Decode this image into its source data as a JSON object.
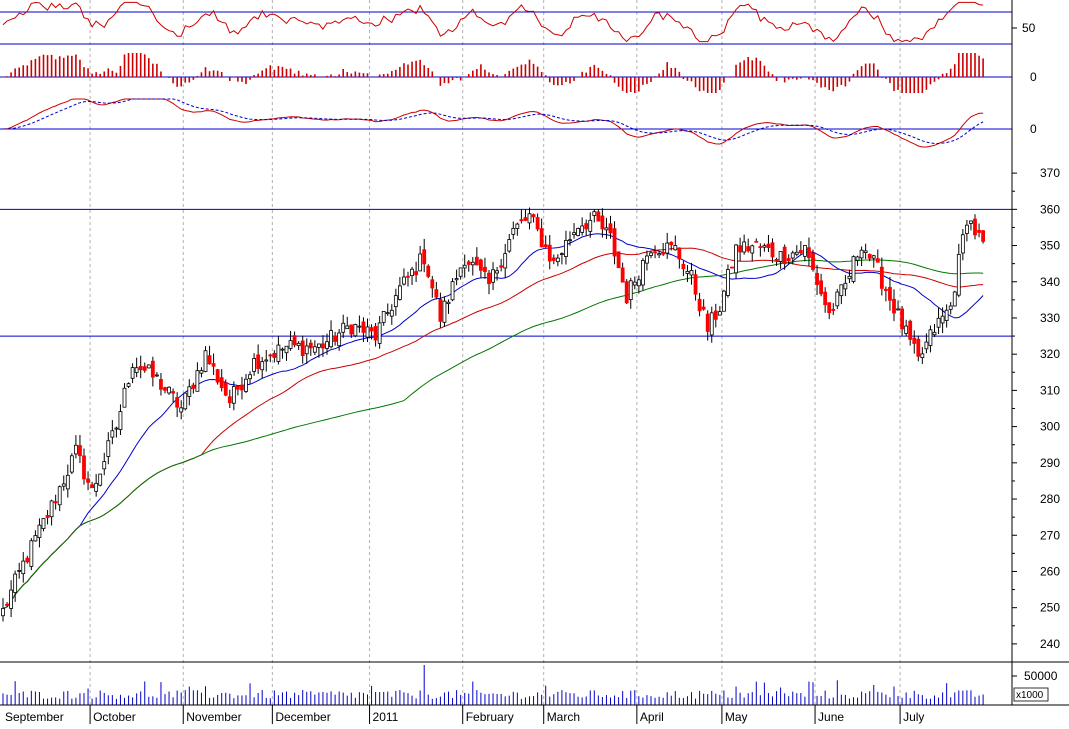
{
  "chart_data": {
    "type": "candlestick",
    "instrument": "",
    "title": "",
    "x_month_labels": [
      "September",
      "October",
      "November",
      "December",
      "2011",
      "February",
      "March",
      "April",
      "May",
      "June",
      "July"
    ],
    "price_panel": {
      "y_ticks": [
        240,
        250,
        260,
        270,
        280,
        290,
        300,
        310,
        320,
        330,
        340,
        350,
        360,
        370
      ],
      "ylim": [
        235,
        375
      ],
      "reference_lines": [
        360,
        325
      ],
      "up_color": "#ffffff",
      "down_color": "#ff0000",
      "moving_averages": [
        {
          "color": "#0000cc",
          "period": 20
        },
        {
          "color": "#cc0000",
          "period": 50
        },
        {
          "color": "#007700",
          "period": 100
        }
      ]
    },
    "rsi_panel": {
      "tick_labels": [
        "50"
      ],
      "reference_lines": [
        70,
        30
      ],
      "line_color": "#cc0000"
    },
    "histogram_panel": {
      "tick_labels": [
        "0"
      ],
      "color": "#cc0000"
    },
    "macd_panel": {
      "tick_labels": [
        "0"
      ],
      "line_color": "#cc0000",
      "signal_color": "#0000cc"
    },
    "volume_panel": {
      "tick_labels": [
        "50000"
      ],
      "unit_label": "x1000",
      "color": "#0000cc"
    },
    "close_waypoints": [
      [
        0,
        249
      ],
      [
        5,
        262
      ],
      [
        12,
        278
      ],
      [
        18,
        293
      ],
      [
        22,
        282
      ],
      [
        28,
        300
      ],
      [
        32,
        318
      ],
      [
        38,
        313
      ],
      [
        44,
        305
      ],
      [
        50,
        320
      ],
      [
        56,
        307
      ],
      [
        62,
        318
      ],
      [
        70,
        322
      ],
      [
        78,
        322
      ],
      [
        86,
        328
      ],
      [
        92,
        325
      ],
      [
        98,
        338
      ],
      [
        104,
        347
      ],
      [
        108,
        330
      ],
      [
        114,
        347
      ],
      [
        120,
        339
      ],
      [
        126,
        354
      ],
      [
        130,
        358
      ],
      [
        136,
        345
      ],
      [
        142,
        356
      ],
      [
        146,
        357
      ],
      [
        150,
        352
      ],
      [
        154,
        336
      ],
      [
        160,
        350
      ],
      [
        166,
        349
      ],
      [
        170,
        341
      ],
      [
        174,
        327
      ],
      [
        177,
        333
      ],
      [
        181,
        349
      ],
      [
        186,
        350
      ],
      [
        192,
        347
      ],
      [
        198,
        349
      ],
      [
        204,
        331
      ],
      [
        208,
        339
      ],
      [
        212,
        351
      ],
      [
        216,
        343
      ],
      [
        222,
        328
      ],
      [
        226,
        318
      ],
      [
        230,
        327
      ],
      [
        234,
        333
      ],
      [
        238,
        358
      ],
      [
        242,
        350
      ]
    ],
    "annotations": []
  }
}
